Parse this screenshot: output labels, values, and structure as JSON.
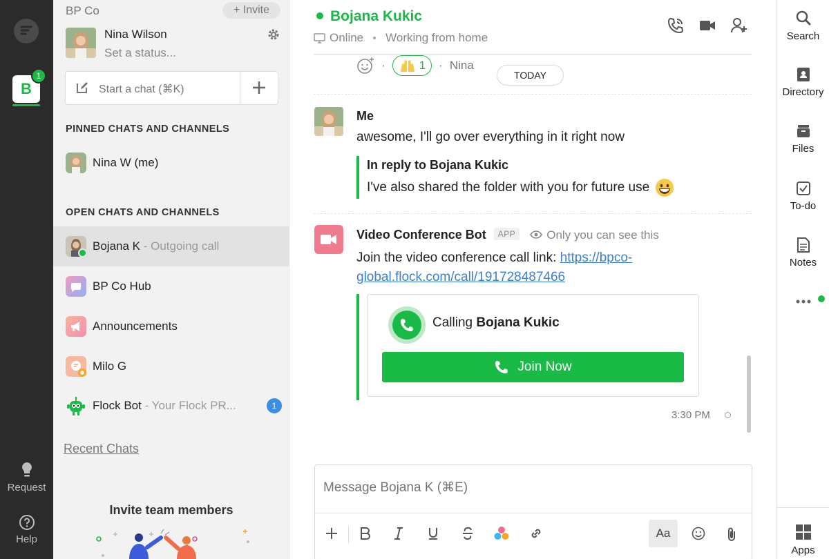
{
  "rail": {
    "team_letter": "B",
    "team_badge": "1",
    "request_label": "Request",
    "help_label": "Help"
  },
  "sidebar": {
    "team_name": "BP Co",
    "invite_label": "+ Invite",
    "user_name": "Nina Wilson",
    "status_placeholder": "Set a status...",
    "start_chat_label": "Start a chat (⌘K)",
    "pinned_title": "PINNED CHATS AND CHANNELS",
    "pinned": [
      {
        "name": "Nina W (me)"
      }
    ],
    "open_title": "OPEN CHATS AND CHANNELS",
    "open": [
      {
        "name": "Bojana K",
        "sub": " - Outgoing call"
      },
      {
        "name": "BP Co Hub",
        "sub": ""
      },
      {
        "name": "Announcements",
        "sub": ""
      },
      {
        "name": "Milo G",
        "sub": ""
      },
      {
        "name": "Flock Bot",
        "sub": " - Your Flock PR...",
        "badge": "1"
      }
    ],
    "recent_chats": "Recent Chats",
    "invite_title": "Invite team members"
  },
  "header": {
    "name": "Bojana Kukic",
    "presence": "Online",
    "status": "Working from home"
  },
  "messages": {
    "reaction_count": "1",
    "reaction_by": "Nina",
    "today": "TODAY",
    "me": {
      "author": "Me",
      "text": "awesome, I'll go over everything in it right now",
      "reply_title": "In reply to Bojana Kukic",
      "reply_text": "I've also shared the folder with you for future use"
    },
    "bot": {
      "author": "Video Conference Bot",
      "tag": "APP",
      "visibility": "Only you can see this",
      "text_prefix": "Join the video conference call link: ",
      "link_line1": "https://bpco-",
      "link_line2": "global.flock.com/call/191728487466",
      "calling_prefix": "Calling ",
      "calling_name": "Bojana Kukic",
      "join_label": "Join Now",
      "time": "3:30 PM"
    }
  },
  "composer": {
    "placeholder": "Message Bojana K (⌘E)",
    "aa_label": "Aa"
  },
  "right_rail": {
    "items": [
      "Search",
      "Directory",
      "Files",
      "To-do",
      "Notes"
    ],
    "apps_label": "Apps"
  },
  "colors": {
    "accent": "#1aba46",
    "rail": "#2b2b2b",
    "link": "#3a80d1",
    "badge_blue": "#3d8ee0",
    "bot_pink": "#f07b8f"
  }
}
